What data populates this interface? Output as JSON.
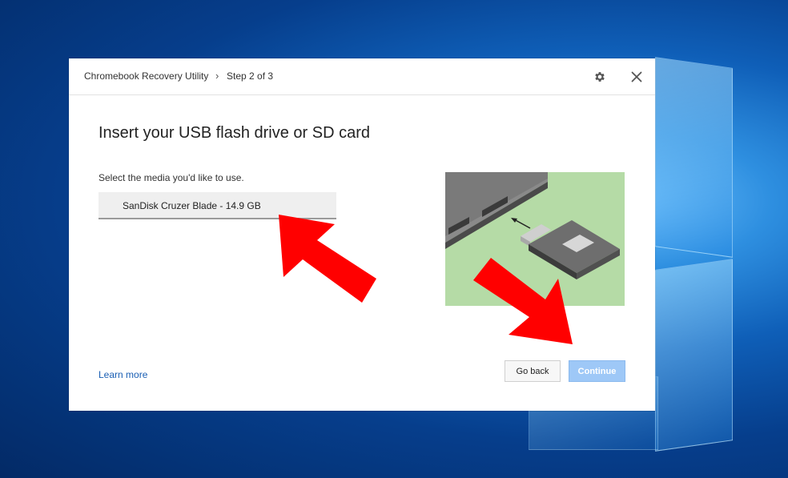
{
  "dialog": {
    "app_title": "Chromebook Recovery Utility",
    "breadcrumb_separator": "›",
    "step": "Step 2 of 3",
    "settings_icon": "gear-icon",
    "close_icon": "close-icon"
  },
  "main": {
    "heading": "Insert your USB flash drive or SD card",
    "select_label": "Select the media you'd like to use.",
    "media_option": "SanDisk Cruzer Blade - 14.9 GB"
  },
  "footer": {
    "learn_more": "Learn more",
    "go_back": "Go back",
    "continue": "Continue"
  },
  "colors": {
    "annotation_arrow": "#ff0000",
    "continue_button": "#9ec8f7",
    "illustration_bg": "#b5dba6",
    "link": "#1a5fb4"
  }
}
